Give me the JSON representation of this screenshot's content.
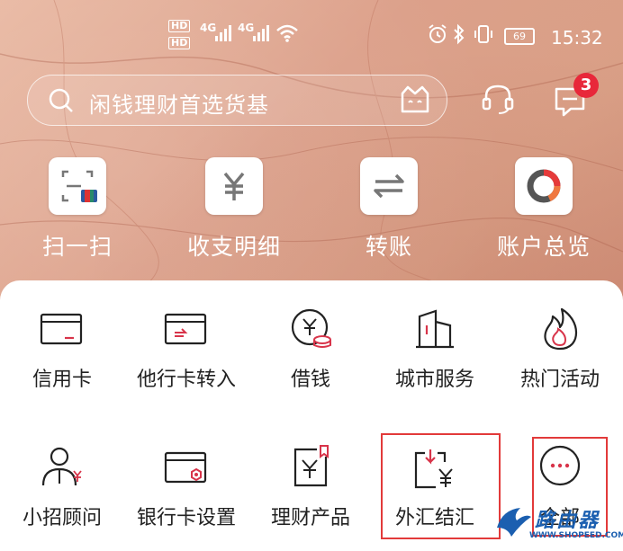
{
  "status_bar": {
    "hd1": "HD",
    "hd2": "HD",
    "net1": "4G",
    "net2": "4G",
    "battery": "69",
    "time": "15:32"
  },
  "search": {
    "placeholder": "闲钱理财首选货基"
  },
  "header": {
    "message_badge": "3"
  },
  "quick_actions": [
    {
      "label": "扫一扫",
      "icon": "scan-icon"
    },
    {
      "label": "收支明细",
      "icon": "yen-icon"
    },
    {
      "label": "转账",
      "icon": "transfer-icon"
    },
    {
      "label": "账户总览",
      "icon": "ring-chart-icon"
    }
  ],
  "grid": [
    {
      "label": "信用卡",
      "icon": "credit-card-icon"
    },
    {
      "label": "他行卡转入",
      "icon": "card-transfer-in-icon"
    },
    {
      "label": "借钱",
      "icon": "borrow-money-icon"
    },
    {
      "label": "城市服务",
      "icon": "city-buildings-icon"
    },
    {
      "label": "热门活动",
      "icon": "flame-icon"
    },
    {
      "label": "小招顾问",
      "icon": "advisor-icon"
    },
    {
      "label": "银行卡设置",
      "icon": "card-settings-icon"
    },
    {
      "label": "理财产品",
      "icon": "wealth-product-icon"
    },
    {
      "label": "外汇结汇",
      "icon": "forex-exchange-icon"
    },
    {
      "label": "全部",
      "icon": "more-icon"
    }
  ],
  "watermark": {
    "text": "路由器",
    "url": "WWW.SHOPEED.COM"
  },
  "colors": {
    "accent": "#e23a3a",
    "badge": "#e8283a",
    "icon_red": "#d8344a"
  }
}
